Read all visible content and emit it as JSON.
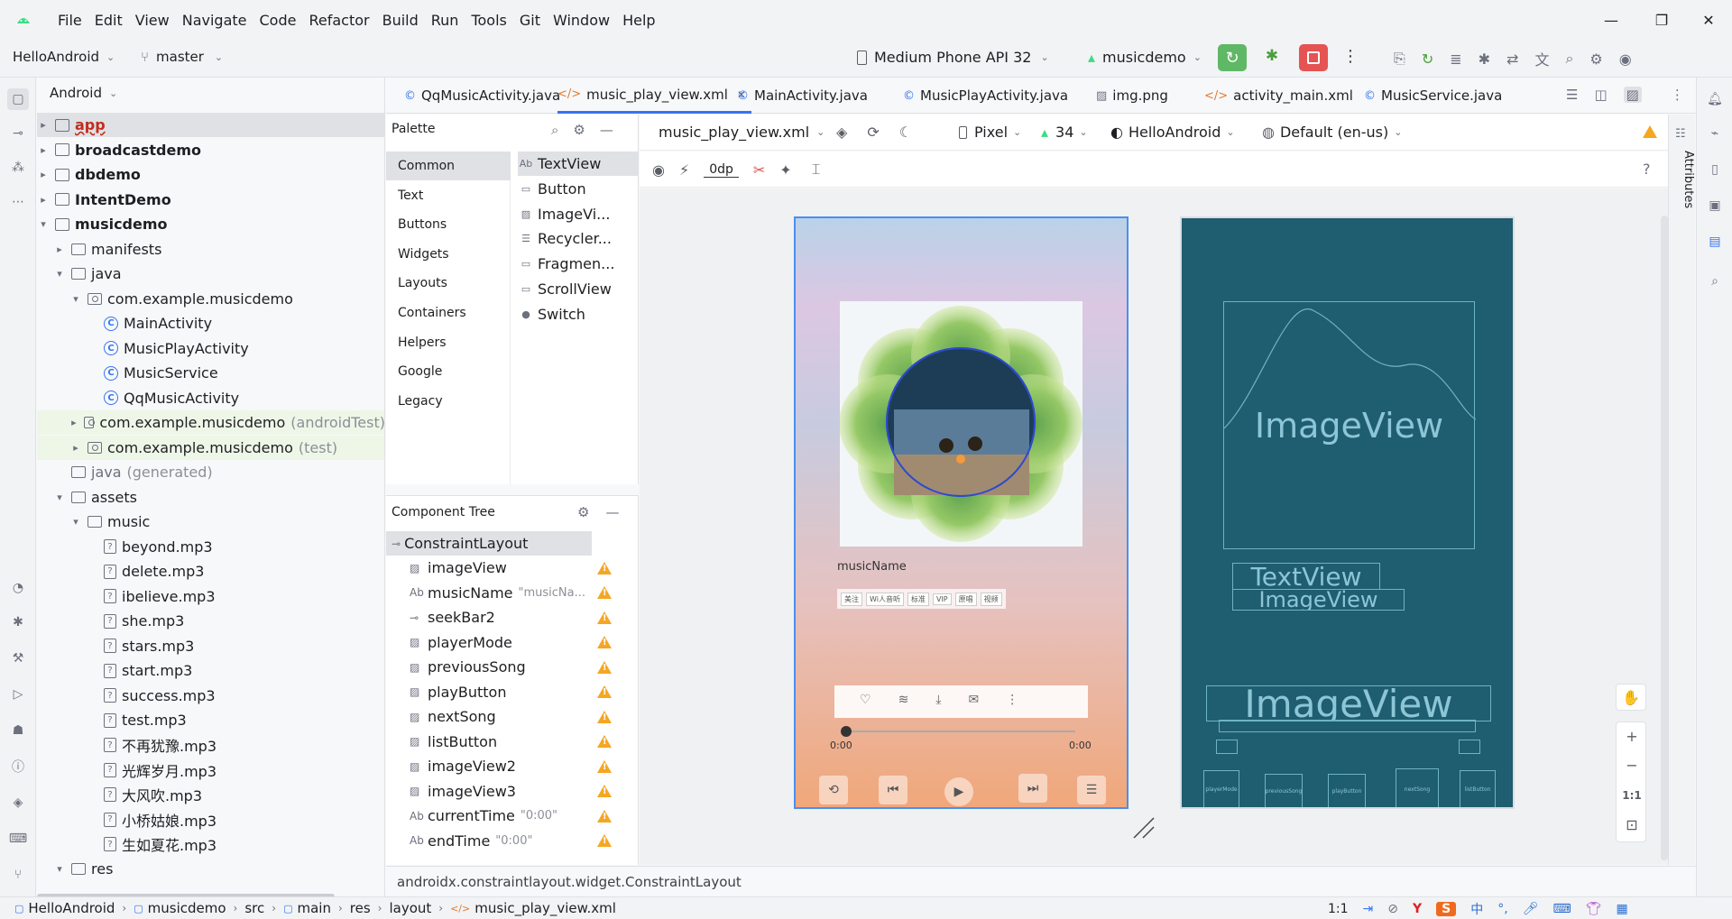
{
  "titlebar": {
    "menus": [
      "File",
      "Edit",
      "View",
      "Navigate",
      "Code",
      "Refactor",
      "Build",
      "Run",
      "Tools",
      "Git",
      "Window",
      "Help"
    ]
  },
  "toolbar": {
    "project": "HelloAndroid",
    "branch": "master",
    "device": "Medium Phone API 32",
    "run_config": "musicdemo"
  },
  "project_panel": {
    "title": "Android",
    "tree": [
      {
        "label": "app",
        "kind": "module",
        "depth": 0,
        "arrow": "▸"
      },
      {
        "label": "broadcastdemo",
        "kind": "module",
        "depth": 0,
        "arrow": "▸"
      },
      {
        "label": "dbdemo",
        "kind": "module",
        "depth": 0,
        "arrow": "▸"
      },
      {
        "label": "IntentDemo",
        "kind": "module",
        "depth": 0,
        "arrow": "▸"
      },
      {
        "label": "musicdemo",
        "kind": "module",
        "depth": 0,
        "arrow": "▾"
      },
      {
        "label": "manifests",
        "kind": "folder",
        "depth": 1,
        "arrow": "▸"
      },
      {
        "label": "java",
        "kind": "folder",
        "depth": 1,
        "arrow": "▾"
      },
      {
        "label": "com.example.musicdemo",
        "kind": "package",
        "depth": 2,
        "arrow": "▾"
      },
      {
        "label": "MainActivity",
        "kind": "class",
        "depth": 3,
        "arrow": ""
      },
      {
        "label": "MusicPlayActivity",
        "kind": "class",
        "depth": 3,
        "arrow": ""
      },
      {
        "label": "MusicService",
        "kind": "class",
        "depth": 3,
        "arrow": ""
      },
      {
        "label": "QqMusicActivity",
        "kind": "class",
        "depth": 3,
        "arrow": ""
      },
      {
        "label": "com.example.musicdemo",
        "suffix": "(androidTest)",
        "kind": "package",
        "depth": 2,
        "arrow": "▸"
      },
      {
        "label": "com.example.musicdemo",
        "suffix": "(test)",
        "kind": "package",
        "depth": 2,
        "arrow": "▸"
      },
      {
        "label": "java",
        "suffix": "(generated)",
        "kind": "folder",
        "depth": 1,
        "arrow": ""
      },
      {
        "label": "assets",
        "kind": "folder",
        "depth": 1,
        "arrow": "▾"
      },
      {
        "label": "music",
        "kind": "folder",
        "depth": 2,
        "arrow": "▾"
      },
      {
        "label": "beyond.mp3",
        "kind": "file",
        "depth": 3,
        "arrow": ""
      },
      {
        "label": "delete.mp3",
        "kind": "file",
        "depth": 3,
        "arrow": ""
      },
      {
        "label": "ibelieve.mp3",
        "kind": "file",
        "depth": 3,
        "arrow": ""
      },
      {
        "label": "she.mp3",
        "kind": "file",
        "depth": 3,
        "arrow": ""
      },
      {
        "label": "stars.mp3",
        "kind": "file",
        "depth": 3,
        "arrow": ""
      },
      {
        "label": "start.mp3",
        "kind": "file",
        "depth": 3,
        "arrow": ""
      },
      {
        "label": "success.mp3",
        "kind": "file",
        "depth": 3,
        "arrow": ""
      },
      {
        "label": "test.mp3",
        "kind": "file",
        "depth": 3,
        "arrow": ""
      },
      {
        "label": "不再犹豫.mp3",
        "kind": "file",
        "depth": 3,
        "arrow": ""
      },
      {
        "label": "光辉岁月.mp3",
        "kind": "file",
        "depth": 3,
        "arrow": ""
      },
      {
        "label": "大风吹.mp3",
        "kind": "file",
        "depth": 3,
        "arrow": ""
      },
      {
        "label": "小桥姑娘.mp3",
        "kind": "file",
        "depth": 3,
        "arrow": ""
      },
      {
        "label": "生如夏花.mp3",
        "kind": "file",
        "depth": 3,
        "arrow": ""
      },
      {
        "label": "res",
        "kind": "folder",
        "depth": 1,
        "arrow": "▾"
      }
    ]
  },
  "editor_tabs": [
    {
      "label": "QqMusicActivity.java",
      "icon": "class-icon"
    },
    {
      "label": "music_play_view.xml",
      "icon": "xml-icon",
      "active": true
    },
    {
      "label": "MainActivity.java",
      "icon": "class-icon"
    },
    {
      "label": "MusicPlayActivity.java",
      "icon": "class-icon"
    },
    {
      "label": "img.png",
      "icon": "image-icon"
    },
    {
      "label": "activity_main.xml",
      "icon": "xml-icon"
    },
    {
      "label": "MusicService.java",
      "icon": "class-icon"
    }
  ],
  "palette": {
    "title": "Palette",
    "categories": [
      "Common",
      "Text",
      "Buttons",
      "Widgets",
      "Layouts",
      "Containers",
      "Helpers",
      "Google",
      "Legacy"
    ],
    "items": [
      {
        "label": "TextView",
        "icon": "Ab"
      },
      {
        "label": "Button",
        "icon": "▭"
      },
      {
        "label": "ImageVi...",
        "icon": "▨"
      },
      {
        "label": "Recycler...",
        "icon": "☰"
      },
      {
        "label": "Fragmen...",
        "icon": "▭"
      },
      {
        "label": "ScrollView",
        "icon": "▭"
      },
      {
        "label": "Switch",
        "icon": "●"
      }
    ]
  },
  "component_tree": {
    "title": "Component Tree",
    "root": "ConstraintLayout",
    "items": [
      {
        "label": "imageView",
        "icon": "▨",
        "hint": ""
      },
      {
        "label": "musicName",
        "icon": "Ab",
        "hint": "\"musicNa..."
      },
      {
        "label": "seekBar2",
        "icon": "⊸",
        "hint": ""
      },
      {
        "label": "playerMode",
        "icon": "▨",
        "hint": ""
      },
      {
        "label": "previousSong",
        "icon": "▨",
        "hint": ""
      },
      {
        "label": "playButton",
        "icon": "▨",
        "hint": ""
      },
      {
        "label": "nextSong",
        "icon": "▨",
        "hint": ""
      },
      {
        "label": "listButton",
        "icon": "▨",
        "hint": ""
      },
      {
        "label": "imageView2",
        "icon": "▨",
        "hint": ""
      },
      {
        "label": "imageView3",
        "icon": "▨",
        "hint": ""
      },
      {
        "label": "currentTime",
        "icon": "Ab",
        "hint": "\"0:00\""
      },
      {
        "label": "endTime",
        "icon": "Ab",
        "hint": "\"0:00\""
      }
    ]
  },
  "design_toolbar": {
    "file": "music_play_view.xml",
    "device": "Pixel",
    "api": "34",
    "theme": "HelloAndroid",
    "locale": "Default (en-us)",
    "margin": "0dp"
  },
  "phone_preview": {
    "music_name": "musicName",
    "tags": [
      "美注",
      "Wi人音听",
      "标准",
      "VIP",
      "原唱",
      "视频"
    ],
    "current_time": "0:00",
    "end_time": "0:00"
  },
  "blueprint": {
    "image_label_1": "ImageView",
    "text_label": "TextView",
    "image_label_2": "ImageView",
    "image_label_3": "ImageView",
    "small_labels": [
      "playerMode",
      "previousSong",
      "playButton",
      "nextSong",
      "listButton"
    ]
  },
  "zoom": {
    "ratio": "1:1"
  },
  "attributes_tab": "Attributes",
  "status_line": "androidx.constraintlayout.widget.ConstraintLayout",
  "breadcrumb": [
    "HelloAndroid",
    "musicdemo",
    "src",
    "main",
    "res",
    "layout",
    "music_play_view.xml"
  ],
  "status_right": {
    "ratio": "1:1",
    "ime": "中"
  }
}
